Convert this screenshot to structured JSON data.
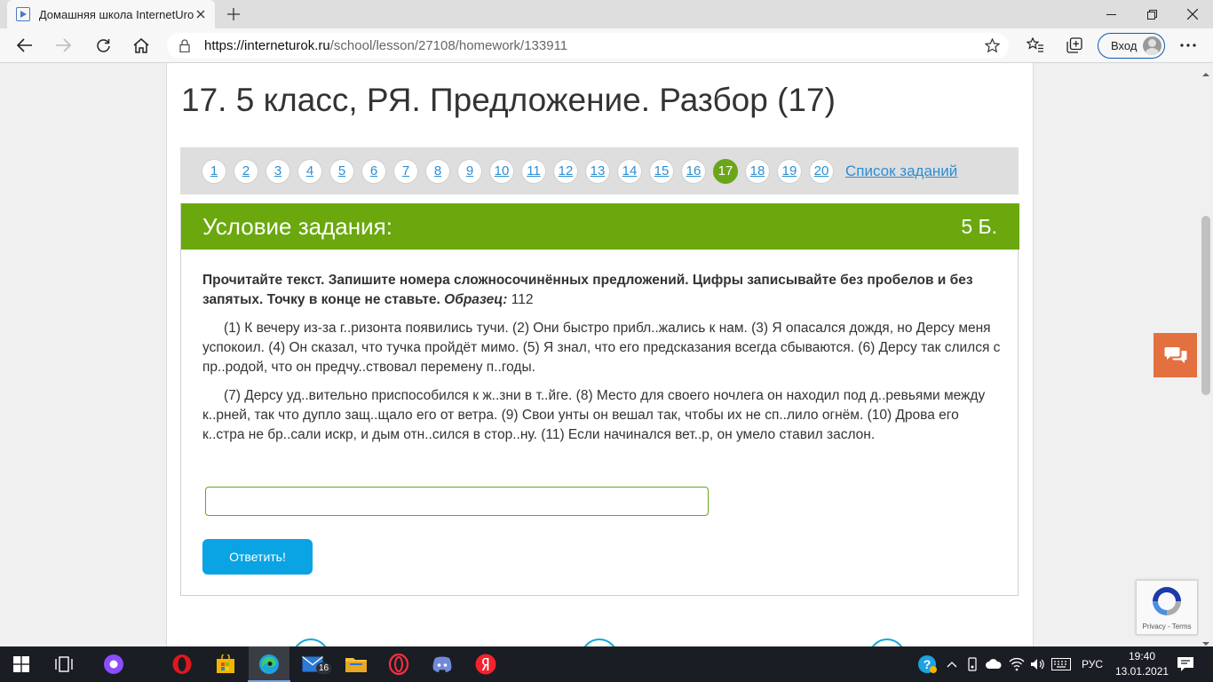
{
  "browser": {
    "tab_title": "Домашняя школа InternetUrok.ru",
    "url_host": "https://interneturok.ru",
    "url_path": "/school/lesson/27108/homework/133911",
    "signin_label": "Вход"
  },
  "page": {
    "title": "17. 5 класс, РЯ. Предложение. Разбор (17)",
    "pager": {
      "pages": [
        "1",
        "2",
        "3",
        "4",
        "5",
        "6",
        "7",
        "8",
        "9",
        "10",
        "11",
        "12",
        "13",
        "14",
        "15",
        "16",
        "17",
        "18",
        "19",
        "20"
      ],
      "active": "17",
      "list_link": "Список заданий"
    },
    "task": {
      "header_title": "Условие задания:",
      "score": "5 Б.",
      "instruction": "Прочитайте текст. Запишите номера сложносочинённых предложений. Цифры записывайте без пробелов и без запятых. Точку в конце не ставьте.",
      "sample_label": "Образец:",
      "sample_value": "112",
      "paragraph1": "(1) К вечеру из-за г..ризонта появились тучи. (2) Они быстро прибл..жались к нам. (3) Я опасался дождя, но Дерсу меня успокоил. (4) Он сказал, что тучка пройдёт мимо. (5) Я знал, что его предсказания всегда сбываются. (6) Дерсу так слился с пр..родой, что он предчу..ствовал перемену п..годы.",
      "paragraph2": "(7) Дерсу уд..вительно приспособился к ж..зни в т..йге. (8) Место для своего ночлега он находил под д..ревьями между к..рней, так что дупло защ..щало его от ветра. (9) Свои унты он вешал так, чтобы их не сп..лило огнём. (10) Дрова его к..стра не бр..сали искр, и дым отн..сился в стор..ну. (11) Если начинался вет..р, он умело ставил заслон.",
      "answer_value": "",
      "submit_label": "Ответить!"
    },
    "recaptcha_text": "Privacy - Terms"
  },
  "taskbar": {
    "mail_badge": "16",
    "language": "РУС",
    "time": "19:40",
    "date": "13.01.2021"
  },
  "colors": {
    "accent_green": "#6aa80e",
    "link_blue": "#2c8ed3",
    "button_blue": "#0aa3e3",
    "chat_orange": "#e3703f"
  }
}
